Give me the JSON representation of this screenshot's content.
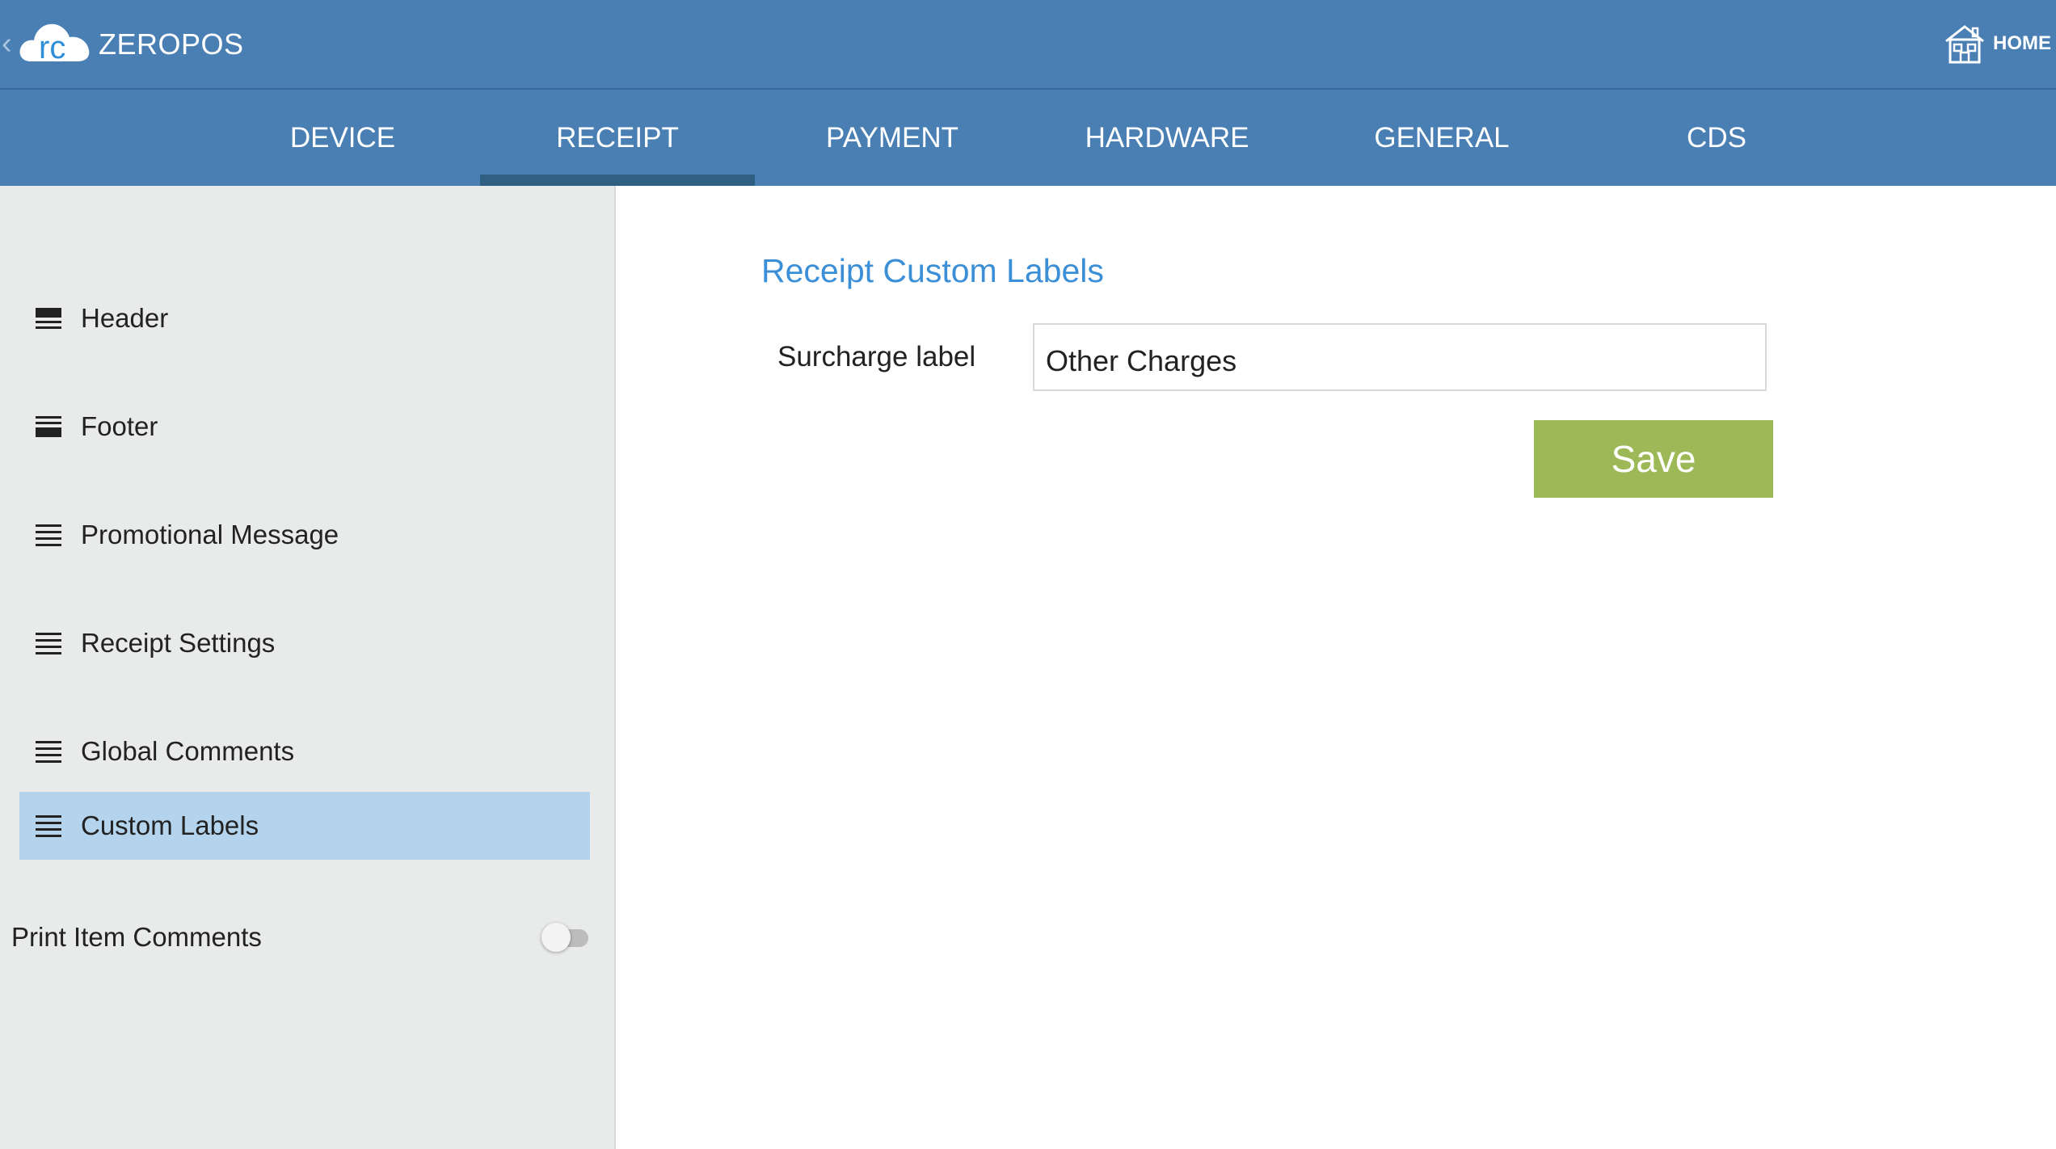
{
  "app": {
    "title": "ZEROPOS",
    "logo_text": "rc",
    "home_label": "HOME"
  },
  "tabs": [
    {
      "label": "DEVICE"
    },
    {
      "label": "RECEIPT",
      "active": true
    },
    {
      "label": "PAYMENT"
    },
    {
      "label": "HARDWARE"
    },
    {
      "label": "GENERAL"
    },
    {
      "label": "CDS"
    }
  ],
  "sidebar": {
    "items": [
      {
        "label": "Header",
        "icon": "header-icon"
      },
      {
        "label": "Footer",
        "icon": "footer-icon"
      },
      {
        "label": "Promotional Message",
        "icon": "list-icon"
      },
      {
        "label": "Receipt Settings",
        "icon": "list-icon"
      },
      {
        "label": "Global Comments",
        "icon": "list-icon"
      },
      {
        "label": "Custom Labels",
        "icon": "list-icon",
        "active": true
      }
    ],
    "print_item_comments": {
      "label": "Print Item Comments",
      "enabled": false
    }
  },
  "main": {
    "section_title": "Receipt Custom Labels",
    "surcharge_label": "Surcharge label",
    "surcharge_value": "Other Charges",
    "save_label": "Save"
  },
  "colors": {
    "header_bg": "#4a7fb4",
    "tab_indicator": "#2f5f82",
    "sidebar_bg": "#e9ebea",
    "sidebar_active": "#b3d4ec",
    "section_title": "#3a8fd6",
    "save_button": "#9db957"
  }
}
